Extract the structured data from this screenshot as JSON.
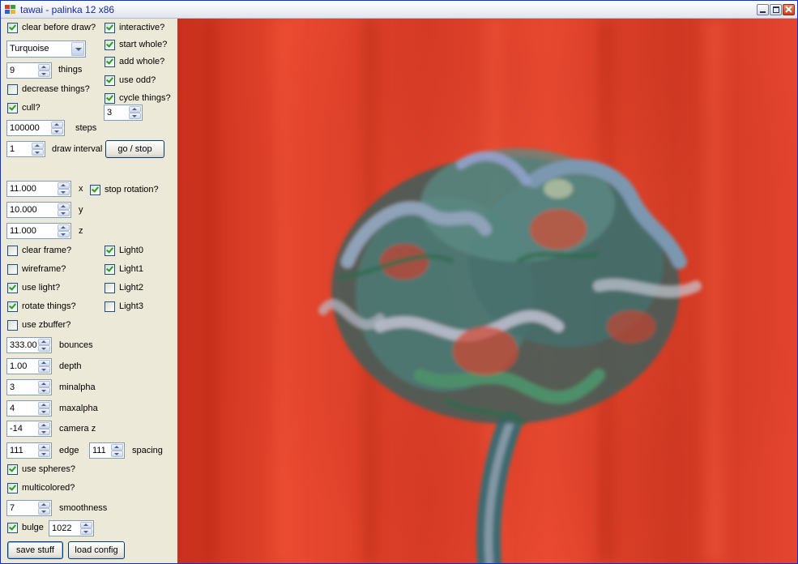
{
  "window": {
    "title": "tawai - palinka 12 x86"
  },
  "colors": {
    "render_background": "#e2402a"
  },
  "controls": {
    "clear_before_draw": {
      "label": "clear before draw?",
      "checked": true
    },
    "interactive": {
      "label": "interactive?",
      "checked": true
    },
    "start_whole": {
      "label": "start whole?",
      "checked": true
    },
    "add_whole": {
      "label": "add whole?",
      "checked": true
    },
    "use_odd": {
      "label": "use odd?",
      "checked": true
    },
    "cycle_things": {
      "label": "cycle things?",
      "checked": true
    },
    "cycle_value": "3",
    "color_select": "Turquoise",
    "things": {
      "value": "9",
      "label": "things"
    },
    "decrease_things": {
      "label": "decrease things?",
      "checked": false
    },
    "cull": {
      "label": "cull?",
      "checked": true
    },
    "steps": {
      "value": "100000",
      "label": "steps"
    },
    "draw_interval": {
      "value": "1",
      "label": "draw interval"
    },
    "go_stop_label": "go / stop",
    "x": {
      "value": "11.000",
      "label": "x"
    },
    "stop_rotation": {
      "label": "stop rotation?",
      "checked": true
    },
    "y": {
      "value": "10.000",
      "label": "y"
    },
    "z": {
      "value": "11.000",
      "label": "z"
    },
    "clear_frame": {
      "label": "clear frame?",
      "checked": false
    },
    "wireframe": {
      "label": "wireframe?",
      "checked": false
    },
    "use_light": {
      "label": "use light?",
      "checked": true
    },
    "rotate_things": {
      "label": "rotate things?",
      "checked": true
    },
    "use_zbuffer": {
      "label": "use zbuffer?",
      "checked": false
    },
    "light0": {
      "label": "Light0",
      "checked": true
    },
    "light1": {
      "label": "Light1",
      "checked": true
    },
    "light2": {
      "label": "Light2",
      "checked": false
    },
    "light3": {
      "label": "Light3",
      "checked": false
    },
    "bounces": {
      "value": "333.00",
      "label": "bounces"
    },
    "depth": {
      "value": "1.00",
      "label": "depth"
    },
    "minalpha": {
      "value": "3",
      "label": "minalpha"
    },
    "maxalpha": {
      "value": "4",
      "label": "maxalpha"
    },
    "camera_z": {
      "value": "-14",
      "label": "camera z"
    },
    "edge": {
      "value": "111",
      "label": "edge"
    },
    "spacing": {
      "value": "111",
      "label": "spacing"
    },
    "use_spheres": {
      "label": "use spheres?",
      "checked": true
    },
    "multicolored": {
      "label": "multicolored?",
      "checked": true
    },
    "smoothness": {
      "value": "7",
      "label": "smoothness"
    },
    "bulge": {
      "label": "bulge",
      "checked": true,
      "value": "1022"
    },
    "save_label": "save stuff",
    "load_label": "load config"
  }
}
